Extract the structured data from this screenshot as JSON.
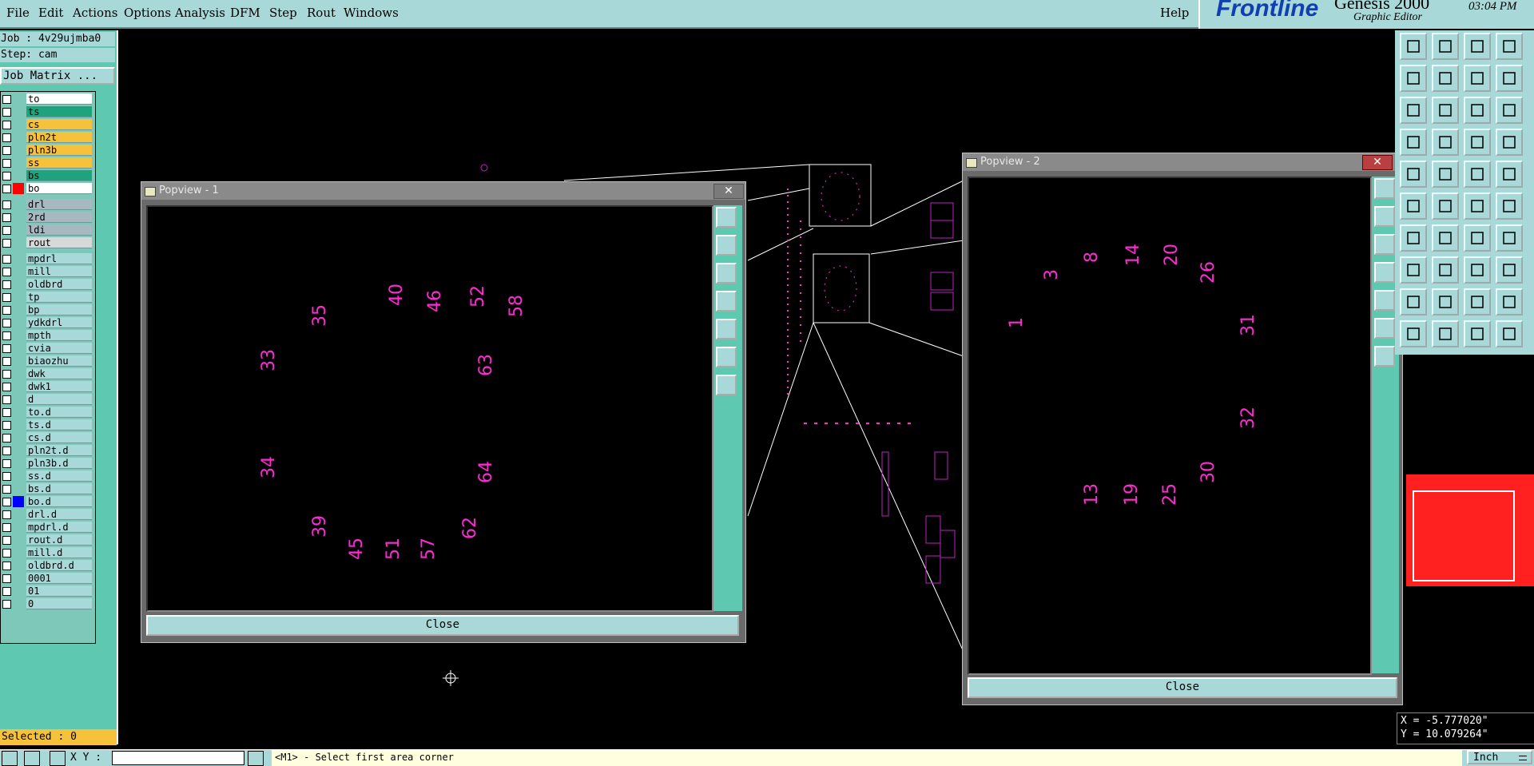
{
  "menu": [
    "File",
    "Edit",
    "Actions",
    "Options",
    "Analysis",
    "DFM",
    "Step",
    "Rout",
    "Windows"
  ],
  "help": "Help",
  "brand": {
    "logo": "Frontline",
    "product": "Genesis 2000",
    "subtitle": "Graphic Editor",
    "time": "03:04 PM"
  },
  "job": {
    "job_line": "Job : 4v29ujmba0",
    "step_line": "Step: cam",
    "matrix_button": "Job Matrix ..."
  },
  "layers": [
    {
      "name": "to",
      "bg": "#ffffff",
      "color": ""
    },
    {
      "name": "ts",
      "bg": "#1ea37c",
      "color": ""
    },
    {
      "name": "cs",
      "bg": "#f6c23c",
      "color": ""
    },
    {
      "name": "pln2t",
      "bg": "#f6c23c",
      "color": ""
    },
    {
      "name": "pln3b",
      "bg": "#f6c23c",
      "color": ""
    },
    {
      "name": "ss",
      "bg": "#f6c23c",
      "color": ""
    },
    {
      "name": "bs",
      "bg": "#1ea37c",
      "color": ""
    },
    {
      "name": "bo",
      "bg": "#ffffff",
      "color": "#ff0000"
    },
    {
      "name": "drl",
      "bg": "#a8b8c0",
      "color": ""
    },
    {
      "name": "2rd",
      "bg": "#a8b8c0",
      "color": ""
    },
    {
      "name": "ldi",
      "bg": "#a8b8c0",
      "color": ""
    },
    {
      "name": "rout",
      "bg": "#d8d8d8",
      "color": ""
    },
    {
      "name": "mpdrl",
      "bg": "#a8d8d8",
      "color": ""
    },
    {
      "name": "mill",
      "bg": "#a8d8d8",
      "color": ""
    },
    {
      "name": "oldbrd",
      "bg": "#a8d8d8",
      "color": ""
    },
    {
      "name": "tp",
      "bg": "#a8d8d8",
      "color": ""
    },
    {
      "name": "bp",
      "bg": "#a8d8d8",
      "color": ""
    },
    {
      "name": "ydkdrl",
      "bg": "#a8d8d8",
      "color": ""
    },
    {
      "name": "mpth",
      "bg": "#a8d8d8",
      "color": ""
    },
    {
      "name": "cvia",
      "bg": "#a8d8d8",
      "color": ""
    },
    {
      "name": "biaozhu",
      "bg": "#a8d8d8",
      "color": ""
    },
    {
      "name": "dwk",
      "bg": "#a8d8d8",
      "color": ""
    },
    {
      "name": "dwk1",
      "bg": "#a8d8d8",
      "color": ""
    },
    {
      "name": "d",
      "bg": "#a8d8d8",
      "color": ""
    },
    {
      "name": "to.d",
      "bg": "#a8d8d8",
      "color": ""
    },
    {
      "name": "ts.d",
      "bg": "#a8d8d8",
      "color": ""
    },
    {
      "name": "cs.d",
      "bg": "#a8d8d8",
      "color": ""
    },
    {
      "name": "pln2t.d",
      "bg": "#a8d8d8",
      "color": ""
    },
    {
      "name": "pln3b.d",
      "bg": "#a8d8d8",
      "color": ""
    },
    {
      "name": "ss.d",
      "bg": "#a8d8d8",
      "color": ""
    },
    {
      "name": "bs.d",
      "bg": "#a8d8d8",
      "color": ""
    },
    {
      "name": "bo.d",
      "bg": "#a8d8d8",
      "color": "#0000ff"
    },
    {
      "name": "drl.d",
      "bg": "#a8d8d8",
      "color": ""
    },
    {
      "name": "mpdrl.d",
      "bg": "#a8d8d8",
      "color": ""
    },
    {
      "name": "rout.d",
      "bg": "#a8d8d8",
      "color": ""
    },
    {
      "name": "mill.d",
      "bg": "#a8d8d8",
      "color": ""
    },
    {
      "name": "oldbrd.d",
      "bg": "#a8d8d8",
      "color": ""
    },
    {
      "name": "0001",
      "bg": "#a8d8d8",
      "color": ""
    },
    {
      "name": "01",
      "bg": "#a8d8d8",
      "color": ""
    },
    {
      "name": "0",
      "bg": "#a8d8d8",
      "color": ""
    }
  ],
  "selected": "Selected : 0",
  "popview1": {
    "title": "Popview - 1",
    "close_label": "Close",
    "labels": [
      "35",
      "40",
      "46",
      "52",
      "58",
      "33",
      "63",
      "34",
      "64",
      "39",
      "45",
      "51",
      "57",
      "62"
    ]
  },
  "popview2": {
    "title": "Popview - 2",
    "close_label": "Close",
    "labels": [
      "3",
      "8",
      "14",
      "20",
      "26",
      "1",
      "31",
      "32",
      "13",
      "19",
      "25",
      "30"
    ]
  },
  "coords": {
    "x": "X = -5.777020\"",
    "y": "Y = 10.079264\""
  },
  "status": {
    "xy_label": "X Y :",
    "xy_value": "",
    "prompt": "<M1> - Select first area corner",
    "units": "Inch"
  },
  "colors": {
    "panel": "#a8d8d8",
    "accent": "#5ec8b0",
    "pad": "#ff2ad4",
    "selected": "#f6c23c"
  }
}
